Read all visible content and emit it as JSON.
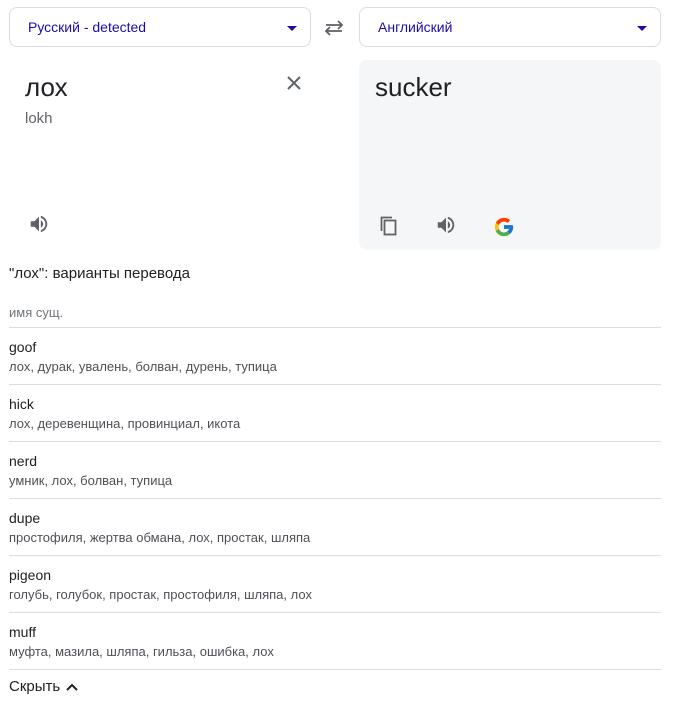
{
  "source_language": {
    "label": "Русский - detected"
  },
  "target_language": {
    "label": "Английский"
  },
  "source": {
    "text": "лох",
    "transliteration": "lokh"
  },
  "target": {
    "text": "sucker"
  },
  "variants": {
    "title": "\"лох\": варианты перевода",
    "part_of_speech": "имя сущ.",
    "rows": [
      {
        "word": "goof",
        "synonyms": "лох, дурак, увалень, болван, дурень, тупица"
      },
      {
        "word": "hick",
        "synonyms": "лох, деревенщина, провинциал, икота"
      },
      {
        "word": "nerd",
        "synonyms": "умник, лох, болван, тупица"
      },
      {
        "word": "dupe",
        "synonyms": "простофиля, жертва обмана, лох, простак, шляпа"
      },
      {
        "word": "pigeon",
        "synonyms": "голубь, голубок, простак, простофиля, шляпа, лох"
      },
      {
        "word": "muff",
        "synonyms": "муфта, мазила, шляпа, гильза, ошибка, лох"
      }
    ]
  },
  "hide_label": "Скрыть",
  "icons": {
    "swap": "swap-arrows-icon",
    "clear": "close-icon",
    "listen": "speaker-icon",
    "copy": "copy-icon",
    "google": "google-logo-icon",
    "collapse": "chevron-up-icon"
  },
  "colors": {
    "link": "#1a0dab",
    "panel_bg": "#f5f6f8",
    "divider": "#dadce0"
  }
}
